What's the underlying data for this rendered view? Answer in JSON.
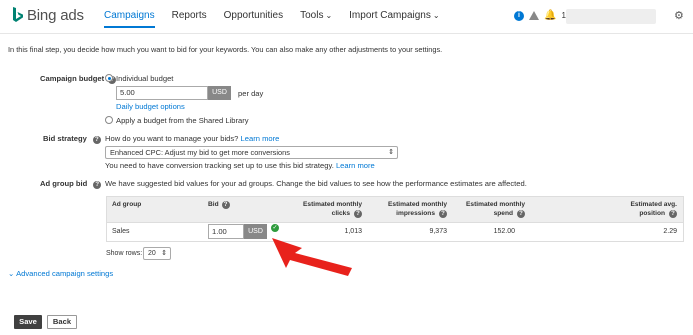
{
  "brand": {
    "name": "Bing ads",
    "logo_color": "#008272"
  },
  "nav": {
    "items": [
      {
        "label": "Campaigns",
        "active": true
      },
      {
        "label": "Reports",
        "active": false
      },
      {
        "label": "Opportunities",
        "active": false
      },
      {
        "label": "Tools",
        "active": false,
        "has_menu": true
      },
      {
        "label": "Import Campaigns",
        "active": false,
        "has_menu": true
      }
    ],
    "notification_count": "1"
  },
  "intro": "In this final step, you decide how much you want to bid for your keywords. You can also make any other adjustments to your settings.",
  "budget": {
    "label": "Campaign budget",
    "option_individual": "Individual budget",
    "amount": "5.00",
    "currency": "USD",
    "per_day": "per day",
    "daily_options_link": "Daily budget options",
    "option_shared": "Apply a budget from the Shared Library"
  },
  "bid_strategy": {
    "label": "Bid strategy",
    "question": "How do you want to manage your bids?",
    "learn_more": "Learn more",
    "selected": "Enhanced CPC: Adjust my bid to get more conversions",
    "note": "You need to have conversion tracking set up to use this bid strategy.",
    "note_link": "Learn more"
  },
  "ad_group_bid": {
    "label": "Ad group bid",
    "description": "We have suggested bid values for your ad groups. Change the bid values to see how the performance estimates are affected.",
    "columns": {
      "ad_group": "Ad group",
      "bid": "Bid",
      "clicks_l1": "Estimated monthly",
      "clicks_l2": "clicks",
      "impr_l1": "Estimated monthly",
      "impr_l2": "impressions",
      "spend_l1": "Estimated monthly",
      "spend_l2": "spend",
      "pos_l1": "Estimated avg.",
      "pos_l2": "position"
    },
    "rows": [
      {
        "ad_group": "Sales",
        "bid": "1.00",
        "currency": "USD",
        "clicks": "1,013",
        "impressions": "9,373",
        "spend": "152.00",
        "position": "2.29"
      }
    ],
    "show_rows_label": "Show rows:",
    "show_rows_value": "20"
  },
  "advanced": "Advanced campaign settings",
  "buttons": {
    "save": "Save",
    "back": "Back"
  },
  "colors": {
    "accent": "#0078d4",
    "arrow": "#e8221c",
    "success": "#2e9b3c"
  }
}
